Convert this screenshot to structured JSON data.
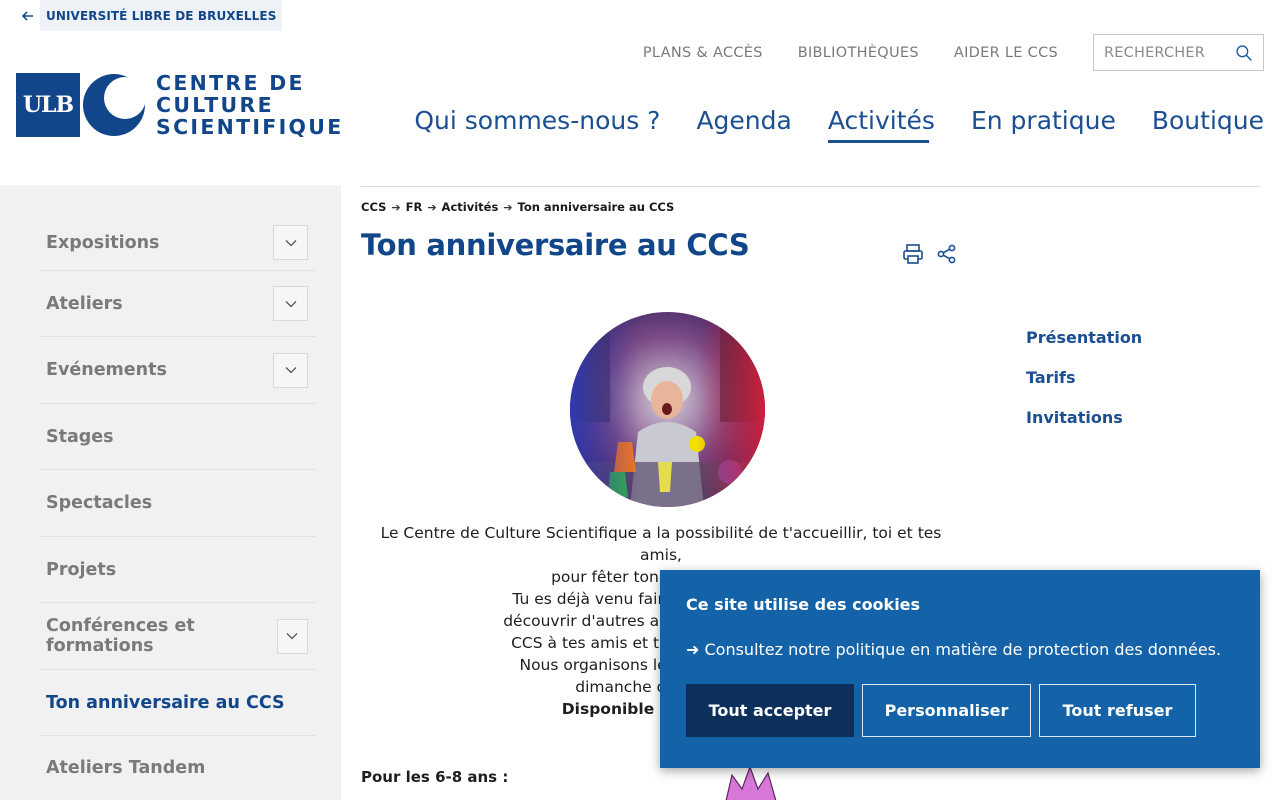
{
  "header": {
    "back_link": "UNIVERSITÉ LIBRE DE BRUXELLES",
    "util_links": [
      "PLANS & ACCÈS",
      "BIBLIOTHÈQUES",
      "AIDER LE CCS"
    ],
    "search_placeholder": "RECHERCHER",
    "logo": {
      "ulb": "ULB",
      "line1": "CENTRE DE",
      "line2": "CULTURE",
      "line3": "SCIENTIFIQUE"
    },
    "main_nav": [
      {
        "label": "Qui sommes-nous ?",
        "active": false
      },
      {
        "label": "Agenda",
        "active": false
      },
      {
        "label": "Activités",
        "active": true
      },
      {
        "label": "En pratique",
        "active": false
      },
      {
        "label": "Boutique",
        "active": false
      }
    ]
  },
  "sidebar": {
    "items": [
      {
        "label": "Expositions",
        "has_toggle": true,
        "active": false
      },
      {
        "label": "Ateliers",
        "has_toggle": true,
        "active": false
      },
      {
        "label": "Evénements",
        "has_toggle": true,
        "active": false
      },
      {
        "label": "Stages",
        "has_toggle": false,
        "active": false
      },
      {
        "label": "Spectacles",
        "has_toggle": false,
        "active": false
      },
      {
        "label": "Projets",
        "has_toggle": false,
        "active": false
      },
      {
        "label": "Conférences et formations",
        "has_toggle": true,
        "active": false
      },
      {
        "label": "Ton anniversaire au CCS",
        "has_toggle": false,
        "active": true
      },
      {
        "label": "Ateliers Tandem",
        "has_toggle": false,
        "active": false
      }
    ]
  },
  "breadcrumb": [
    "CCS",
    "FR",
    "Activités",
    "Ton anniversaire au CCS"
  ],
  "page_title": "Ton anniversaire au CCS",
  "intro": {
    "line1": "Le Centre de Culture Scientifique a la possibilité de t'accueillir, toi et tes amis,",
    "line2": "pour fêter ton anniversaire !",
    "line3": "Tu es déjà venu faire une activité au C",
    "line4": "découvrir d'autres activités ? Ou alors tu",
    "line5": "CCS à tes amis et ta famille ? Alors vie",
    "line6": "Nous organisons les anniversaires le",
    "line7": "dimanche du mois (se",
    "line8": "Disponible durant tout"
  },
  "age_label": "Pour les 6-8 ans :",
  "anchor_menu": [
    "Présentation",
    "Tarifs",
    "Invitations"
  ],
  "cookie": {
    "title": "Ce site utilise des cookies",
    "text": "➜ Consultez notre politique en matière de protection des données.",
    "accept": "Tout accepter",
    "customize": "Personnaliser",
    "refuse": "Tout refuser"
  },
  "colors": {
    "brand_blue": "#12468a",
    "nav_blue": "#1b4f91",
    "cookie_bg": "#1462a8",
    "cookie_primary_btn": "#0c2f5c",
    "sidebar_bg": "#f1f1f1"
  }
}
